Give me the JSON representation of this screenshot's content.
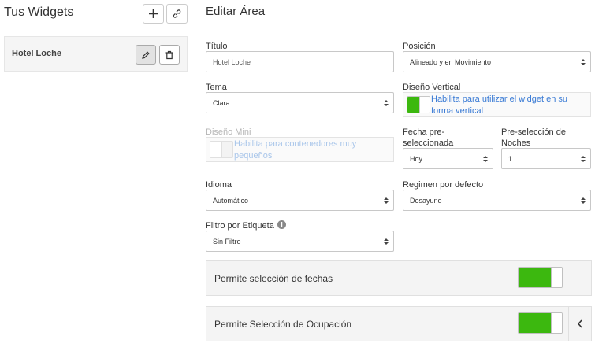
{
  "left": {
    "title": "Tus Widgets",
    "add_icon": "plus-icon",
    "link_icon": "link-icon",
    "widgets": [
      {
        "name": "Hotel Loche",
        "edit_icon": "pencil-icon",
        "delete_icon": "trash-icon"
      }
    ]
  },
  "editor": {
    "title": "Editar Área",
    "titulo": {
      "label": "Título",
      "value": "Hotel Loche"
    },
    "posicion": {
      "label": "Posición",
      "value": "Alineado y en Movimiento"
    },
    "tema": {
      "label": "Tema",
      "value": "Clara"
    },
    "diseno_vertical": {
      "label": "Diseño Vertical",
      "text": "Habilita para utilizar el widget en su forma vertical",
      "on": true
    },
    "diseno_mini": {
      "label": "Diseño Mini",
      "text": "Habilita para contenedores muy pequeños",
      "on": false,
      "disabled": true
    },
    "fecha_pre": {
      "label": "Fecha pre-seleccionada",
      "value": "Hoy"
    },
    "noches": {
      "label": "Pre-selección de Noches",
      "value": "1"
    },
    "idioma": {
      "label": "Idioma",
      "value": "Automático"
    },
    "regimen": {
      "label": "Regimen por defecto",
      "value": "Desayuno"
    },
    "filtro": {
      "label": "Filtro por Etiqueta",
      "value": "Sin Filtro",
      "info_icon": "info-icon"
    },
    "fechas_toggle": {
      "label": "Permite selección de fechas",
      "on": true
    },
    "ocupacion_toggle": {
      "label": "Permite Selección de Ocupación",
      "on": true,
      "chevron_icon": "chevron-left-icon"
    }
  },
  "colors": {
    "accent_green": "#3cb80f",
    "link_blue": "#3a7bd5"
  }
}
